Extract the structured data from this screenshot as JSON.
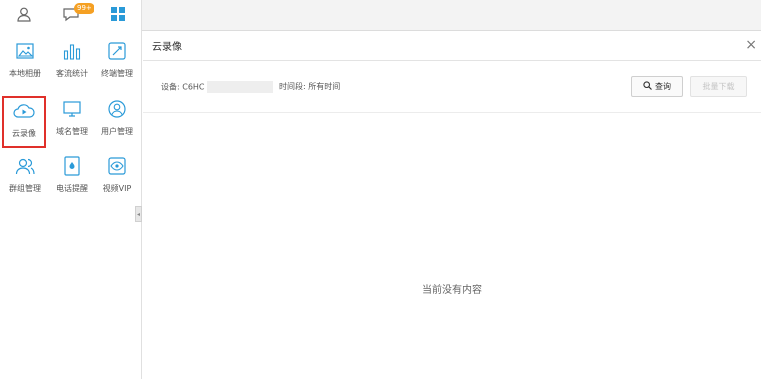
{
  "topbar": {
    "tabs": [
      {
        "icon": "user-icon"
      },
      {
        "icon": "chat-bubble-icon",
        "badge": "99+"
      },
      {
        "icon": "apps-grid-icon"
      }
    ]
  },
  "apps": [
    {
      "label": "本地相册",
      "icon": "photo-album-icon"
    },
    {
      "label": "客流统计",
      "icon": "bar-chart-icon"
    },
    {
      "label": "终端管理",
      "icon": "device-manage-icon"
    },
    {
      "label": "云录像",
      "icon": "cloud-video-icon"
    },
    {
      "label": "域名管理",
      "icon": "monitor-icon"
    },
    {
      "label": "用户管理",
      "icon": "user-manage-icon"
    },
    {
      "label": "群组管理",
      "icon": "group-icon"
    },
    {
      "label": "电话提醒",
      "icon": "phone-icon"
    },
    {
      "label": "视频VIP",
      "icon": "eye-vip-icon"
    }
  ],
  "panel": {
    "title": "云录像",
    "close": "×",
    "device_label": "设备: C6HC",
    "time_label": "时间段: 所有时间",
    "query_button": "查询",
    "download_button": "批量下载",
    "empty_text": "当前没有内容"
  },
  "colors": {
    "accent": "#2a9ad8",
    "selected_border": "#e0302a",
    "badge": "#f5a023"
  }
}
